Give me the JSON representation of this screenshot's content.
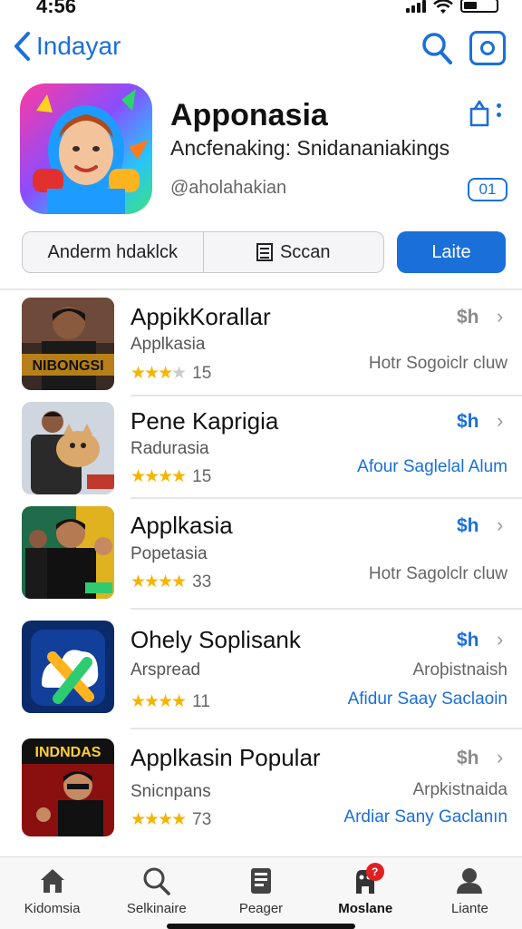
{
  "status": {
    "time": "4:56"
  },
  "nav": {
    "back_label": "Indayar"
  },
  "app": {
    "title": "Apponasia",
    "subtitle": "Ancfenaking:  Snidananiakings",
    "handle": "@aholahakian",
    "count": "01"
  },
  "segments": {
    "left": "Anderm hdaklck",
    "middle": "Sccan",
    "primary": "Laite"
  },
  "list": [
    {
      "title": "AppikKorallar",
      "subtitle": "Applkasia",
      "rating": "15",
      "price": "$h",
      "price_color": "#8a8a8a",
      "note": "Hotr Sogoiclr cluw",
      "note_color": "#666666",
      "note2": "",
      "thumb_text": "NIBONGSI"
    },
    {
      "title": "Pene Kaprigia",
      "subtitle": "Radurasia",
      "rating": "15",
      "price": "$h",
      "price_color": "#1a6fd9",
      "note": "Afour Saglelal Alum",
      "note_color": "#1a6fd9",
      "note2": "",
      "thumb_text": ""
    },
    {
      "title": "Applkasia",
      "subtitle": "Popetasia",
      "rating": "33",
      "price": "$h",
      "price_color": "#1a6fd9",
      "note": "Hotr Sagolclr cluw",
      "note_color": "#666666",
      "note2": "",
      "thumb_text": ""
    },
    {
      "title": "Ohely Soplisank",
      "subtitle": "Arspread",
      "rating": "11",
      "price": "$h",
      "price_color": "#1a6fd9",
      "note": "Afidur Saay Saclaoin",
      "note_color": "#1a6fd9",
      "note2": "Aroþistnaish",
      "thumb_text": ""
    },
    {
      "title": "Applkasin Popular",
      "subtitle": "Snicnpans",
      "rating": "73",
      "price": "$h",
      "price_color": "#8a8a8a",
      "note": "Ardiar Sany Gaclanın",
      "note_color": "#1a6fd9",
      "note2": "Arpkistnaida",
      "thumb_text": "INDNDAS"
    }
  ],
  "tabs": [
    {
      "label": "Kidomsia",
      "icon": "home-icon"
    },
    {
      "label": "Selkinaire",
      "icon": "search-icon"
    },
    {
      "label": "Peager",
      "icon": "document-icon"
    },
    {
      "label": "Moslane",
      "icon": "games-icon",
      "active": true,
      "badge": "?"
    },
    {
      "label": "Liante",
      "icon": "person-icon"
    }
  ]
}
